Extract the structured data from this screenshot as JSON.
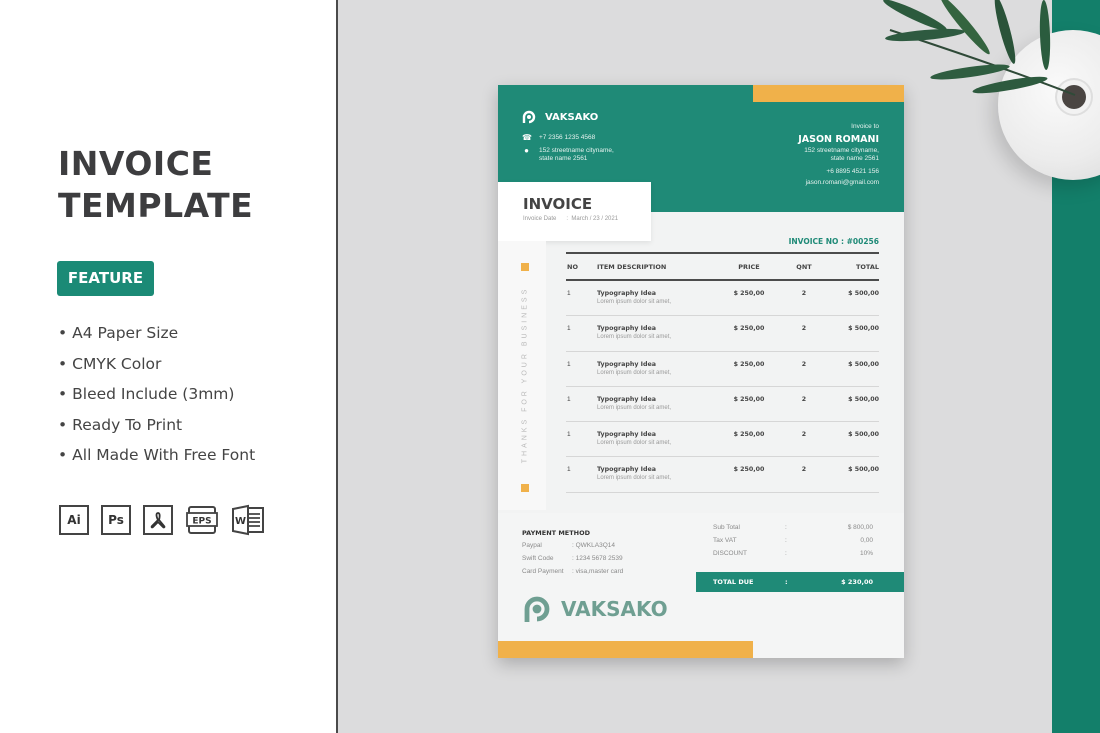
{
  "promo": {
    "title_line1": "INVOICE",
    "title_line2": "TEMPLATE",
    "badge": "FEATURE",
    "features": [
      "A4 Paper Size",
      "CMYK Color",
      "Bleed Include (3mm)",
      "Ready To Print",
      "All Made With Free Font"
    ],
    "bullet": "•",
    "app_icons": [
      {
        "name": "illustrator-icon",
        "label": "Ai"
      },
      {
        "name": "photoshop-icon",
        "label": "Ps"
      },
      {
        "name": "acrobat-pdf-icon",
        "label": ""
      },
      {
        "name": "eps-icon",
        "label": "EPS"
      },
      {
        "name": "word-icon",
        "label": "W"
      }
    ]
  },
  "colors": {
    "brand_green": "#1f8a77",
    "accent_yellow": "#f0b14a",
    "dark_text": "#3d3d3f",
    "scene_bg": "#dcdcdd"
  },
  "invoice": {
    "company": {
      "name": "VAKSAKO",
      "phone": "+7 2356 1235 4568",
      "address_line1": "152 streetname cityname,",
      "address_line2": "state name 2561"
    },
    "bill_to": {
      "label": "Invoice to",
      "name": "JASON ROMANI",
      "address_line1": "152 streetname cityname,",
      "address_line2": "state name 2561",
      "phone": "+6 8895 4521 156",
      "email": "jason.romani@gmail.com"
    },
    "heading": "INVOICE",
    "date_label": "Invoice Date",
    "date_value": ":  March / 23 / 2021",
    "number_label": "INVOICE NO : #00256",
    "side_text": "THANKS FOR YOUR BUSINESS",
    "table": {
      "headers": [
        "NO",
        "ITEM DESCRIPTION",
        "PRICE",
        "QNT",
        "TOTAL"
      ],
      "rows": [
        {
          "no": "1",
          "item": "Typography Idea",
          "desc": "Lorem ipsum dolor sit amet,",
          "price": "$ 250,00",
          "qnt": "2",
          "total": "$ 500,00"
        },
        {
          "no": "1",
          "item": "Typography Idea",
          "desc": "Lorem ipsum dolor sit amet,",
          "price": "$ 250,00",
          "qnt": "2",
          "total": "$ 500,00"
        },
        {
          "no": "1",
          "item": "Typography Idea",
          "desc": "Lorem ipsum dolor sit amet,",
          "price": "$ 250,00",
          "qnt": "2",
          "total": "$ 500,00"
        },
        {
          "no": "1",
          "item": "Typography Idea",
          "desc": "Lorem ipsum dolor sit amet,",
          "price": "$ 250,00",
          "qnt": "2",
          "total": "$ 500,00"
        },
        {
          "no": "1",
          "item": "Typography Idea",
          "desc": "Lorem ipsum dolor sit amet,",
          "price": "$ 250,00",
          "qnt": "2",
          "total": "$ 500,00"
        },
        {
          "no": "1",
          "item": "Typography Idea",
          "desc": "Lorem ipsum dolor sit amet,",
          "price": "$ 250,00",
          "qnt": "2",
          "total": "$ 500,00"
        }
      ]
    },
    "payment": {
      "title": "PAYMENT METHOD",
      "rows": [
        {
          "key": "Paypal",
          "value": ":  QWKLA3Q14"
        },
        {
          "key": "Swift Code",
          "value": ":  1234 5678 2539"
        },
        {
          "key": "Card Payment",
          "value": ":  visa,master card"
        }
      ]
    },
    "summary": {
      "rows": [
        {
          "key": "Sub Total",
          "colon": ":",
          "value": "$ 800,00"
        },
        {
          "key": "Tax VAT",
          "colon": ":",
          "value": "0,00"
        },
        {
          "key": "DISCOUNT",
          "colon": ":",
          "value": "10%"
        }
      ],
      "total_label": "TOTAL DUE",
      "total_colon": ":",
      "total_value": "$ 230,00"
    },
    "footer_brand": "VAKSAKO"
  }
}
